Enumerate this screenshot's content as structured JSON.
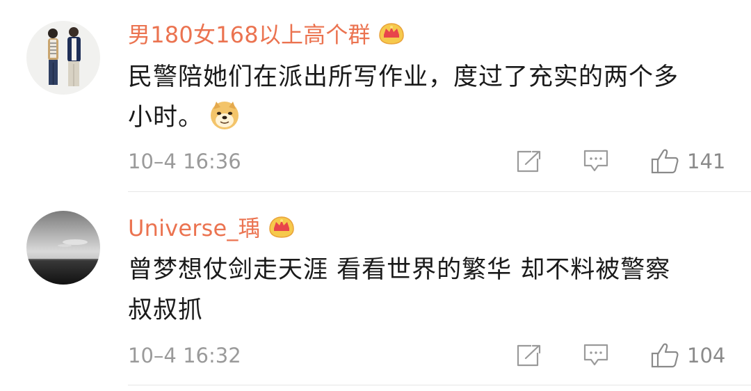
{
  "comments": [
    {
      "username": "男180女168以上高个群",
      "badge_icon": "vip-crown-icon",
      "text_line1": "民警陪她们在派出所写作业，度过了充实的两个多",
      "text_line2": "小时。",
      "emoji_icon": "doge-emoji-icon",
      "timestamp": "10–4 16:36",
      "like_count": "141",
      "avatar_icon": "couple-photo-avatar"
    },
    {
      "username": "Universe_瑀",
      "badge_icon": "vip-crown-icon",
      "text_line1": "曾梦想仗剑走天涯 看看世界的繁华  却不料被警察",
      "text_line2": "叔叔抓",
      "timestamp": "10–4 16:32",
      "like_count": "104",
      "avatar_icon": "sea-horizon-avatar"
    }
  ],
  "actions": {
    "share_icon": "share-icon",
    "reply_icon": "comment-icon",
    "like_icon": "thumbs-up-icon"
  },
  "colors": {
    "username": "#eb7350",
    "text": "#1a1a1a",
    "meta": "#9a9a9a",
    "divider": "#e6e6e6"
  }
}
